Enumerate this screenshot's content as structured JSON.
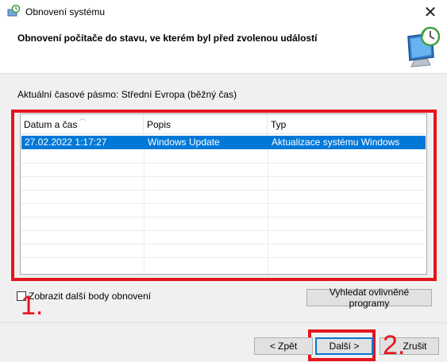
{
  "window": {
    "title": "Obnovení systému",
    "close_glyph": "✕",
    "app_icon": "system-restore-icon"
  },
  "header": {
    "heading": "Obnovení počítače do stavu, ve kterém byl před zvolenou událostí",
    "illustration": "system-restore-monitor-icon"
  },
  "timezone_label": "Aktuální časové pásmo: Střední Evropa (běžný čas)",
  "restore_points": {
    "columns": [
      "Datum a čas",
      "Popis",
      "Typ"
    ],
    "sorted_column": "Datum a čas",
    "rows": [
      {
        "date": "27.02.2022 1:17:27",
        "description": "Windows Update",
        "type": "Aktualizace systému Windows",
        "selected": true
      }
    ]
  },
  "show_more_checkbox": {
    "label": "Zobrazit další body obnovení",
    "checked": false
  },
  "buttons": {
    "scan": "Vyhledat ovlivněné programy",
    "back": "< Zpět",
    "next": "Další >",
    "cancel": "Zrušit"
  },
  "annotations": {
    "step1": "1.",
    "step2": "2."
  },
  "colors": {
    "highlight": "#e5151e",
    "selection": "#0078d7"
  }
}
